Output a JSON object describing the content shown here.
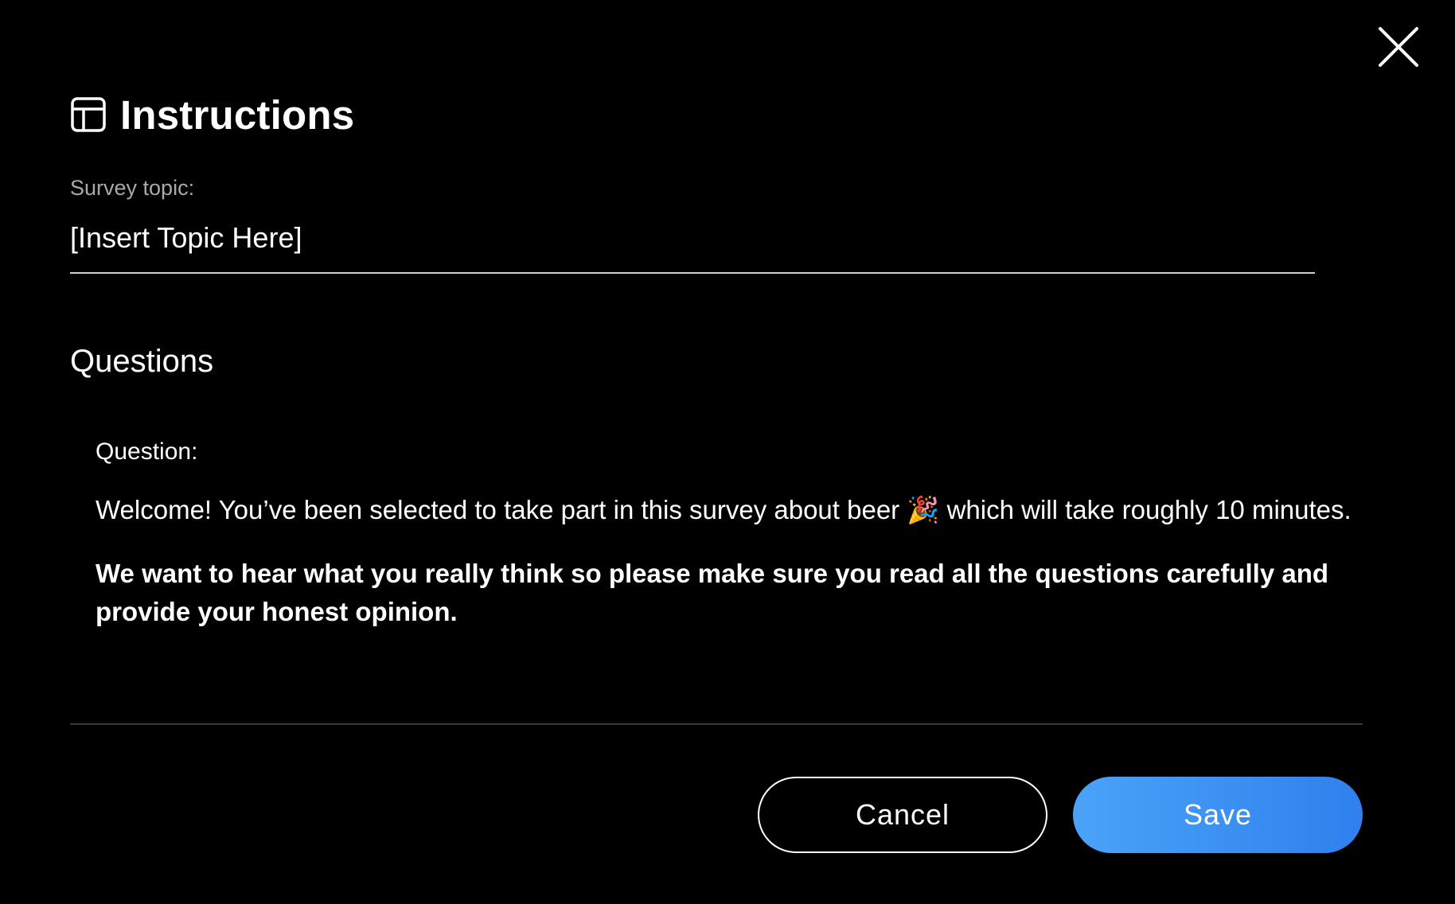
{
  "dialog": {
    "title": "Instructions",
    "header_icon": "layout-template-icon",
    "close_icon": "close-icon"
  },
  "survey_topic": {
    "label": "Survey topic:",
    "value": "[Insert Topic Here]"
  },
  "questions": {
    "section_title": "Questions",
    "items": [
      {
        "label": "Question:",
        "body": "Welcome! You’ve been selected to take part in this survey about beer 🎉 which will take roughly 10 minutes.",
        "emphasis": "We want to hear what you really think so please make sure you read all the questions carefully and provide your honest opinion."
      }
    ]
  },
  "actions": {
    "cancel_label": "Cancel",
    "save_label": "Save"
  },
  "colors": {
    "background": "#000000",
    "text": "#ffffff",
    "muted_label": "#a9a9a9",
    "accent_start": "#4aa3f8",
    "accent_end": "#2f80ed"
  }
}
